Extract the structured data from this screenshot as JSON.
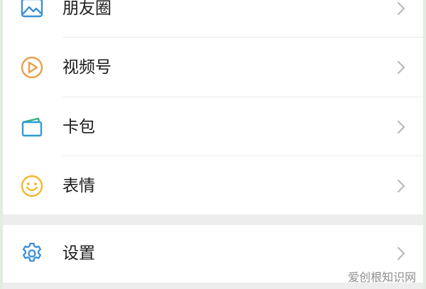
{
  "menu": {
    "items": [
      {
        "label": "朋友圈",
        "icon": "moments-icon"
      },
      {
        "label": "视频号",
        "icon": "channels-icon"
      },
      {
        "label": "卡包",
        "icon": "card-wallet-icon"
      },
      {
        "label": "表情",
        "icon": "sticker-icon"
      }
    ],
    "settings": {
      "label": "设置",
      "icon": "gear-icon"
    }
  },
  "watermark": "爱创根知识网",
  "colors": {
    "moments_icon": "#3a8fd8",
    "channels_icon": "#e8a04a",
    "card_wallet_icon": "#2f9bd6",
    "sticker_icon": "#efb92a",
    "settings_icon": "#3a8fd8",
    "chevron": "#b9b9b9"
  }
}
